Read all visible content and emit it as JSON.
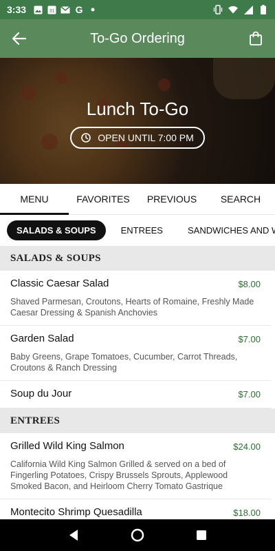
{
  "status_bar": {
    "time": "3:33",
    "calendar_day": "31",
    "icons_left": [
      "image-icon",
      "calendar-icon",
      "mail-icon",
      "google-icon",
      "dot-icon"
    ],
    "icons_right": [
      "vibrate-icon",
      "wifi-icon",
      "signal-icon",
      "battery-icon"
    ]
  },
  "app_bar": {
    "title": "To-Go Ordering"
  },
  "hero": {
    "title": "Lunch To-Go",
    "hours_label": "OPEN UNTIL 7:00 PM"
  },
  "main_tabs": [
    {
      "label": "MENU",
      "active": true
    },
    {
      "label": "FAVORITES",
      "active": false
    },
    {
      "label": "PREVIOUS",
      "active": false
    },
    {
      "label": "SEARCH",
      "active": false
    }
  ],
  "category_chips": [
    {
      "label": "SALADS & SOUPS",
      "active": true
    },
    {
      "label": "ENTREES",
      "active": false
    },
    {
      "label": "SANDWICHES AND WRAPS",
      "active": false
    }
  ],
  "sections": [
    {
      "title": "SALADS & SOUPS",
      "items": [
        {
          "name": "Classic Caesar Salad",
          "price": "$8.00",
          "description": " Shaved Parmesan, Croutons, Hearts of Romaine, Freshly Made Caesar Dressing & Spanish Anchovies"
        },
        {
          "name": "Garden Salad",
          "price": "$7.00",
          "description": "Baby Greens, Grape Tomatoes, Cucumber, Carrot Threads, Croutons & Ranch Dressing"
        },
        {
          "name": "Soup du Jour",
          "price": "$7.00",
          "description": ""
        }
      ]
    },
    {
      "title": "ENTREES",
      "items": [
        {
          "name": "Grilled Wild King Salmon",
          "price": "$24.00",
          "description": "California Wild King Salmon Grilled & served on a bed of Fingerling Potatoes, Crispy Brussels Sprouts, Applewood Smoked Bacon, and Heirloom Cherry Tomato Gastrique"
        },
        {
          "name": "Montecito Shrimp Quesadilla",
          "price": "$18.00",
          "description": ""
        }
      ]
    }
  ],
  "colors": {
    "status_bar": "#3f7a4a",
    "app_bar": "#5a8a5c",
    "price": "#2e6b34",
    "section_bg": "#e8e8e8"
  }
}
